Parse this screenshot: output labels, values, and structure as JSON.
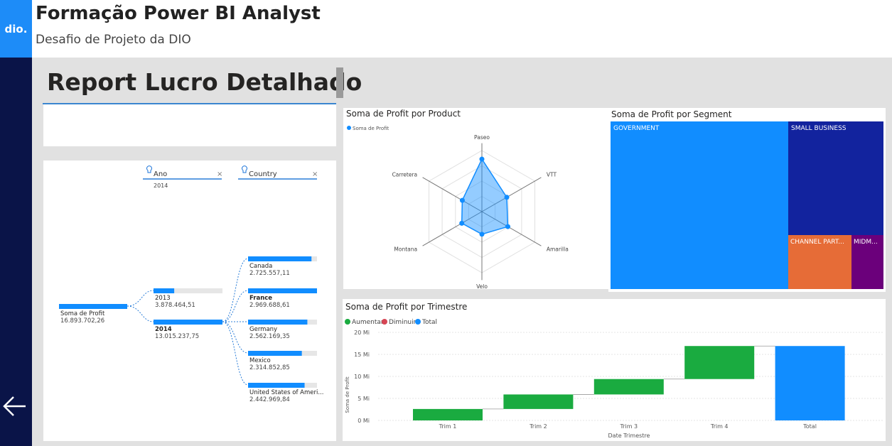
{
  "header": {
    "logo_text": "dio.",
    "title": "Formação Power BI Analyst",
    "subtitle": "Desafio de Projeto da DIO"
  },
  "report_title": "Report Lucro Detalhado",
  "decomposition": {
    "filters": [
      {
        "label": "Ano",
        "value": "2014"
      },
      {
        "label": "Country",
        "value": ""
      }
    ],
    "root": {
      "label": "Soma de Profit",
      "value": "16.893.702,26",
      "fraction": 1.0
    },
    "years": [
      {
        "label": "2013",
        "value": "3.878.464,51",
        "fraction": 0.3,
        "selected": false
      },
      {
        "label": "2014",
        "value": "13.015.237,75",
        "fraction": 1.0,
        "selected": true
      }
    ],
    "countries": [
      {
        "label": "Canada",
        "value": "2.725.557,11",
        "fraction": 0.92,
        "selected": false
      },
      {
        "label": "France",
        "value": "2.969.688,61",
        "fraction": 1.0,
        "selected": true
      },
      {
        "label": "Germany",
        "value": "2.562.169,35",
        "fraction": 0.86,
        "selected": false
      },
      {
        "label": "Mexico",
        "value": "2.314.852,85",
        "fraction": 0.78,
        "selected": false
      },
      {
        "label": "United States of Ameri...",
        "value": "2.442.969,84",
        "fraction": 0.82,
        "selected": false
      }
    ]
  },
  "colors": {
    "accent": "#118dff",
    "increase": "#1aab40",
    "decrease": "#d64554",
    "total": "#118dff",
    "government": "#118dff",
    "small_business": "#12239e",
    "channel_partners": "#e66c37",
    "midmarket": "#6b007b",
    "sidebar": "#0a1448"
  },
  "chart_data": [
    {
      "type": "radar",
      "title": "Soma de Profit por Product",
      "legend": "Soma de Profit",
      "categories": [
        "Paseo",
        "VTT",
        "Amarilla",
        "Velo",
        "Montana",
        "Carretera"
      ],
      "values": [
        0.86,
        0.47,
        0.49,
        0.37,
        0.38,
        0.37
      ],
      "value_scale": "relative (0-1 of axis max)"
    },
    {
      "type": "treemap",
      "title": "Soma de Profit por Segment",
      "categories": [
        "GOVERNMENT",
        "SMALL BUSINESS",
        "CHANNEL PART...",
        "MIDM..."
      ],
      "values": [
        0.6,
        0.25,
        0.09,
        0.06
      ],
      "value_scale": "share of total"
    },
    {
      "type": "waterfall",
      "title": "Soma de Profit por Trimestre",
      "legend": [
        "Aumentar",
        "Diminuir",
        "Total"
      ],
      "xlabel": "Date Trimestre",
      "ylabel": "Soma de Profit",
      "y_ticks": [
        "0 Mi",
        "5 Mi",
        "10 Mi",
        "15 Mi",
        "20 Mi"
      ],
      "ylim": [
        0,
        20
      ],
      "categories": [
        "Trim 1",
        "Trim 2",
        "Trim 3",
        "Trim 4",
        "Total"
      ],
      "values": [
        2.6,
        3.3,
        3.5,
        7.5,
        16.9
      ],
      "kinds": [
        "increase",
        "increase",
        "increase",
        "increase",
        "total"
      ]
    }
  ]
}
